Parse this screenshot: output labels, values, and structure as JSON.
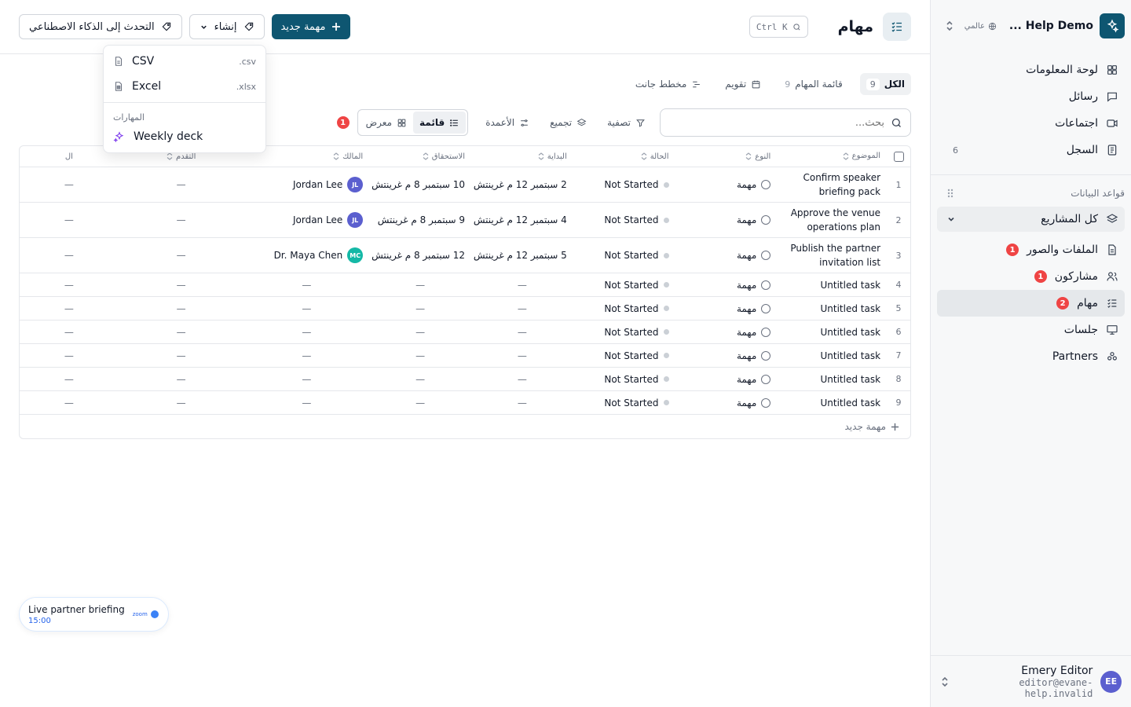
{
  "workspace": {
    "name": "Help Demo ...",
    "scope": "عالمي"
  },
  "sidebar": {
    "nav": [
      {
        "label": "لوحة المعلومات",
        "icon": "dashboard-icon"
      },
      {
        "label": "رسائل",
        "icon": "message-icon"
      },
      {
        "label": "اجتماعات",
        "icon": "video-icon"
      },
      {
        "label": "السجل",
        "icon": "log-icon",
        "count": "6"
      }
    ],
    "databases_label": "قواعد البيانات",
    "all_projects": "كل المشاريع",
    "dbs": [
      {
        "label": "الملفات والصور",
        "icon": "file-icon",
        "badge": "1"
      },
      {
        "label": "مشاركون",
        "icon": "users-icon",
        "badge": "1"
      },
      {
        "label": "مهام",
        "icon": "tasks-icon",
        "badge": "2",
        "active": true
      },
      {
        "label": "جلسات",
        "icon": "presentation-icon"
      },
      {
        "label": "Partners",
        "icon": "partners-icon"
      }
    ],
    "user": {
      "initials": "EE",
      "name": "Emery Editor",
      "email": "editor@evane-help.invalid"
    }
  },
  "header": {
    "title": "مهام",
    "shortcut": "Ctrl K",
    "new_task": "مهمة جديد",
    "create": "إنشاء",
    "ai_chat": "التحدث إلى الذكاء الاصطناعي"
  },
  "views": [
    {
      "label": "الكل",
      "count": "9",
      "active": true
    },
    {
      "label": "قائمة المهام",
      "count": "9"
    },
    {
      "label": "تقويم"
    },
    {
      "label": "مخطط جانت"
    }
  ],
  "toolbar": {
    "search_placeholder": "بحث...",
    "filter": "تصفية",
    "group": "تجميع",
    "columns": "الأعمدة",
    "list": "قائمة",
    "gallery": "معرض",
    "alert_badge": "1"
  },
  "dropdown": {
    "items": [
      {
        "label": "CSV",
        "ext": ".csv"
      },
      {
        "label": "Excel",
        "ext": ".xlsx"
      }
    ],
    "skills_label": "المهارات",
    "skill": "Weekly deck"
  },
  "table": {
    "headers": {
      "subject": "الموضوع",
      "type": "النوع",
      "status": "الحالة",
      "start": "البداية",
      "due": "الاستحقاق",
      "owner": "المالك",
      "progress": "التقدم",
      "last": "ال"
    },
    "rows": [
      {
        "n": "1",
        "subject": "Confirm speaker briefing pack",
        "type": "مهمة",
        "status": "Not Started",
        "start": "2 سبتمبر 12 م غرينتش",
        "due": "10 سبتمبر 8 م غرينتش",
        "owner": "Jordan Lee",
        "owner_initials": "JL",
        "owner_color": "#5b5fcf",
        "progress": "—",
        "last": "—"
      },
      {
        "n": "2",
        "subject": "Approve the venue operations plan",
        "type": "مهمة",
        "status": "Not Started",
        "start": "4 سبتمبر 12 م غرينتش",
        "due": "9 سبتمبر 8 م غرينتش",
        "owner": "Jordan Lee",
        "owner_initials": "JL",
        "owner_color": "#5b5fcf",
        "progress": "—",
        "last": "—"
      },
      {
        "n": "3",
        "subject": "Publish the partner invitation list",
        "type": "مهمة",
        "status": "Not Started",
        "start": "5 سبتمبر 12 م غرينتش",
        "due": "12 سبتمبر 8 م غرينتش",
        "owner": "Dr. Maya Chen",
        "owner_initials": "MC",
        "owner_color": "#14b8a6",
        "progress": "—",
        "last": "—"
      },
      {
        "n": "4",
        "subject": "Untitled task",
        "type": "مهمة",
        "status": "Not Started",
        "start": "—",
        "due": "—",
        "owner": "—",
        "progress": "—",
        "last": "—"
      },
      {
        "n": "5",
        "subject": "Untitled task",
        "type": "مهمة",
        "status": "Not Started",
        "start": "—",
        "due": "—",
        "owner": "—",
        "progress": "—",
        "last": "—"
      },
      {
        "n": "6",
        "subject": "Untitled task",
        "type": "مهمة",
        "status": "Not Started",
        "start": "—",
        "due": "—",
        "owner": "—",
        "progress": "—",
        "last": "—"
      },
      {
        "n": "7",
        "subject": "Untitled task",
        "type": "مهمة",
        "status": "Not Started",
        "start": "—",
        "due": "—",
        "owner": "—",
        "progress": "—",
        "last": "—"
      },
      {
        "n": "8",
        "subject": "Untitled task",
        "type": "مهمة",
        "status": "Not Started",
        "start": "—",
        "due": "—",
        "owner": "—",
        "progress": "—",
        "last": "—"
      },
      {
        "n": "9",
        "subject": "Untitled task",
        "type": "مهمة",
        "status": "Not Started",
        "start": "—",
        "due": "—",
        "owner": "—",
        "progress": "—",
        "last": "—"
      }
    ],
    "new_row": "مهمة جديد"
  },
  "meeting": {
    "title": "Live partner briefing",
    "time": "15:00",
    "provider": "zoom"
  },
  "colors": {
    "brand": "#0e5671",
    "badge_red": "#ef4444"
  }
}
